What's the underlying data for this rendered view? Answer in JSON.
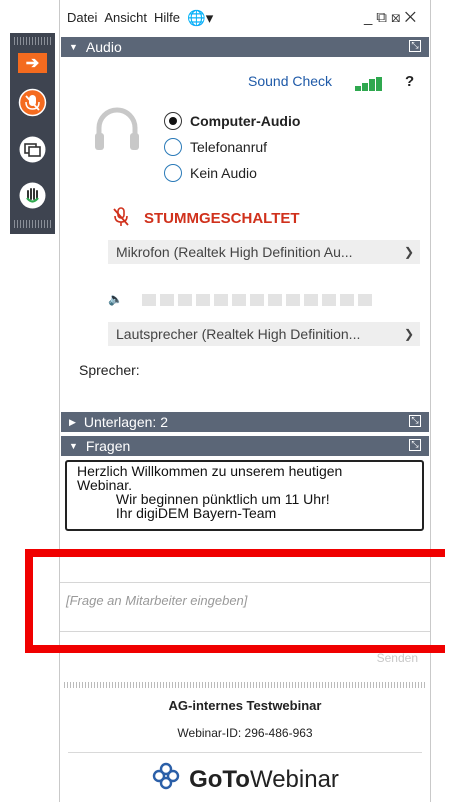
{
  "menu": {
    "file": "Datei",
    "view": "Ansicht",
    "help": "Hilfe"
  },
  "audio": {
    "section_title": "Audio",
    "sound_check": "Sound Check",
    "help_mark": "?",
    "options": [
      "Computer-Audio",
      "Telefonanruf",
      "Kein Audio"
    ],
    "selected_option": "Computer-Audio",
    "mute_status": "STUMMGESCHALTET",
    "microphone": "Mikrofon (Realtek High Definition Au...",
    "speaker": "Lautsprecher (Realtek High Definition...",
    "speaker_label": "Sprecher:"
  },
  "handouts": {
    "section_title": "Unterlagen: 2"
  },
  "questions": {
    "section_title": "Fragen",
    "welcome_message": "Herzlich Willkommen zu unserem heutigen\nWebinar.\n          Wir beginnen pünktlich um 11 Uhr!\n          Ihr digiDEM Bayern-Team",
    "input_placeholder": "[Frage an Mitarbeiter eingeben]",
    "send_label": "Senden"
  },
  "footer": {
    "webinar_title": "AG-internes Testwebinar",
    "webinar_id": "Webinar-ID: 296-486-963",
    "brand_goto": "GoTo",
    "brand_webinar": "Webinar"
  },
  "colors": {
    "header": "#5b6677",
    "accent_orange": "#f46b1f",
    "mute_red": "#d0311c",
    "highlight": "#f00000",
    "link": "#1f5aa8"
  },
  "icons": [
    "arrow-right-icon",
    "mic-muted-icon",
    "screen-share-icon",
    "raise-hand-icon",
    "globe-icon",
    "headset-icon",
    "speaker-icon",
    "gotowebinar-logo-icon"
  ]
}
